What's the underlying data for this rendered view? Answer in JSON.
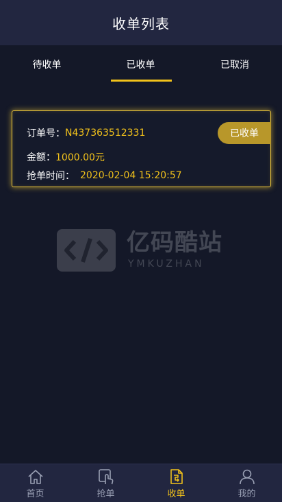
{
  "header": {
    "title": "收单列表"
  },
  "tabs": [
    {
      "label": "待收单",
      "active": false
    },
    {
      "label": "已收单",
      "active": true
    },
    {
      "label": "已取消",
      "active": false
    }
  ],
  "order": {
    "order_no_label": "订单号：",
    "order_no": "N437363512331",
    "amount_label": "金额：",
    "amount": "1000.00元",
    "time_label": "抢单时间：",
    "time": "2020-02-04 15:20:57",
    "status": "已收单"
  },
  "watermark": {
    "name": "亿码酷站",
    "sub": "YMKUZHAN"
  },
  "bottom_nav": [
    {
      "label": "首页",
      "icon": "home-icon",
      "active": false
    },
    {
      "label": "抢单",
      "icon": "grab-order-icon",
      "active": false
    },
    {
      "label": "收单",
      "icon": "receive-order-icon",
      "active": true
    },
    {
      "label": "我的",
      "icon": "user-icon",
      "active": false
    }
  ],
  "colors": {
    "accent": "#f2c21b",
    "background": "#141828",
    "bar": "#222640",
    "badge": "#b8972a"
  }
}
